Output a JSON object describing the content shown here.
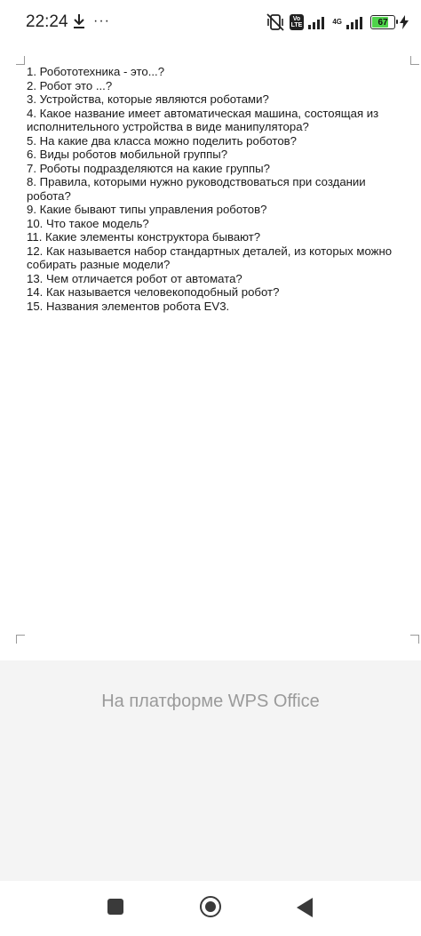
{
  "status_bar": {
    "time": "22:24",
    "more": "···",
    "network": "4G",
    "volte": "Vo LTE",
    "battery_level": "67",
    "icons": [
      "download-icon",
      "mute-vibrate-icon",
      "signal-icon",
      "charging-icon"
    ]
  },
  "document": {
    "lines": [
      "1. Робототехника - это...?",
      "2. Робот это ...?",
      "3. Устройства, которые являются роботами?",
      "4. Какое название имеет автоматическая машина, состоящая из",
      "исполнительного устройства в виде манипулятора?",
      "5. На какие два класса можно поделить роботов?",
      "6. Виды роботов мобильной группы?",
      "7. Роботы подразделяются на какие группы?",
      "8. Правила, которыми нужно руководствоваться при создании",
      "робота?",
      "9. Какие бывают типы управления роботов?",
      "10. Что такое модель?",
      "11. Какие элементы конструктора бывают?",
      "12. Как называется набор стандартных деталей, из которых можно",
      "собирать разные модели?",
      "13. Чем отличается робот от автомата?",
      "14. Как называется человекоподобный робот?",
      "15. Названия элементов робота EV3."
    ]
  },
  "footer": {
    "wps_text": "На платформе WPS Office"
  },
  "colors": {
    "battery_fill": "#4fd34b",
    "footer_bg": "#f4f4f4",
    "footer_text": "#9a9a9a"
  }
}
